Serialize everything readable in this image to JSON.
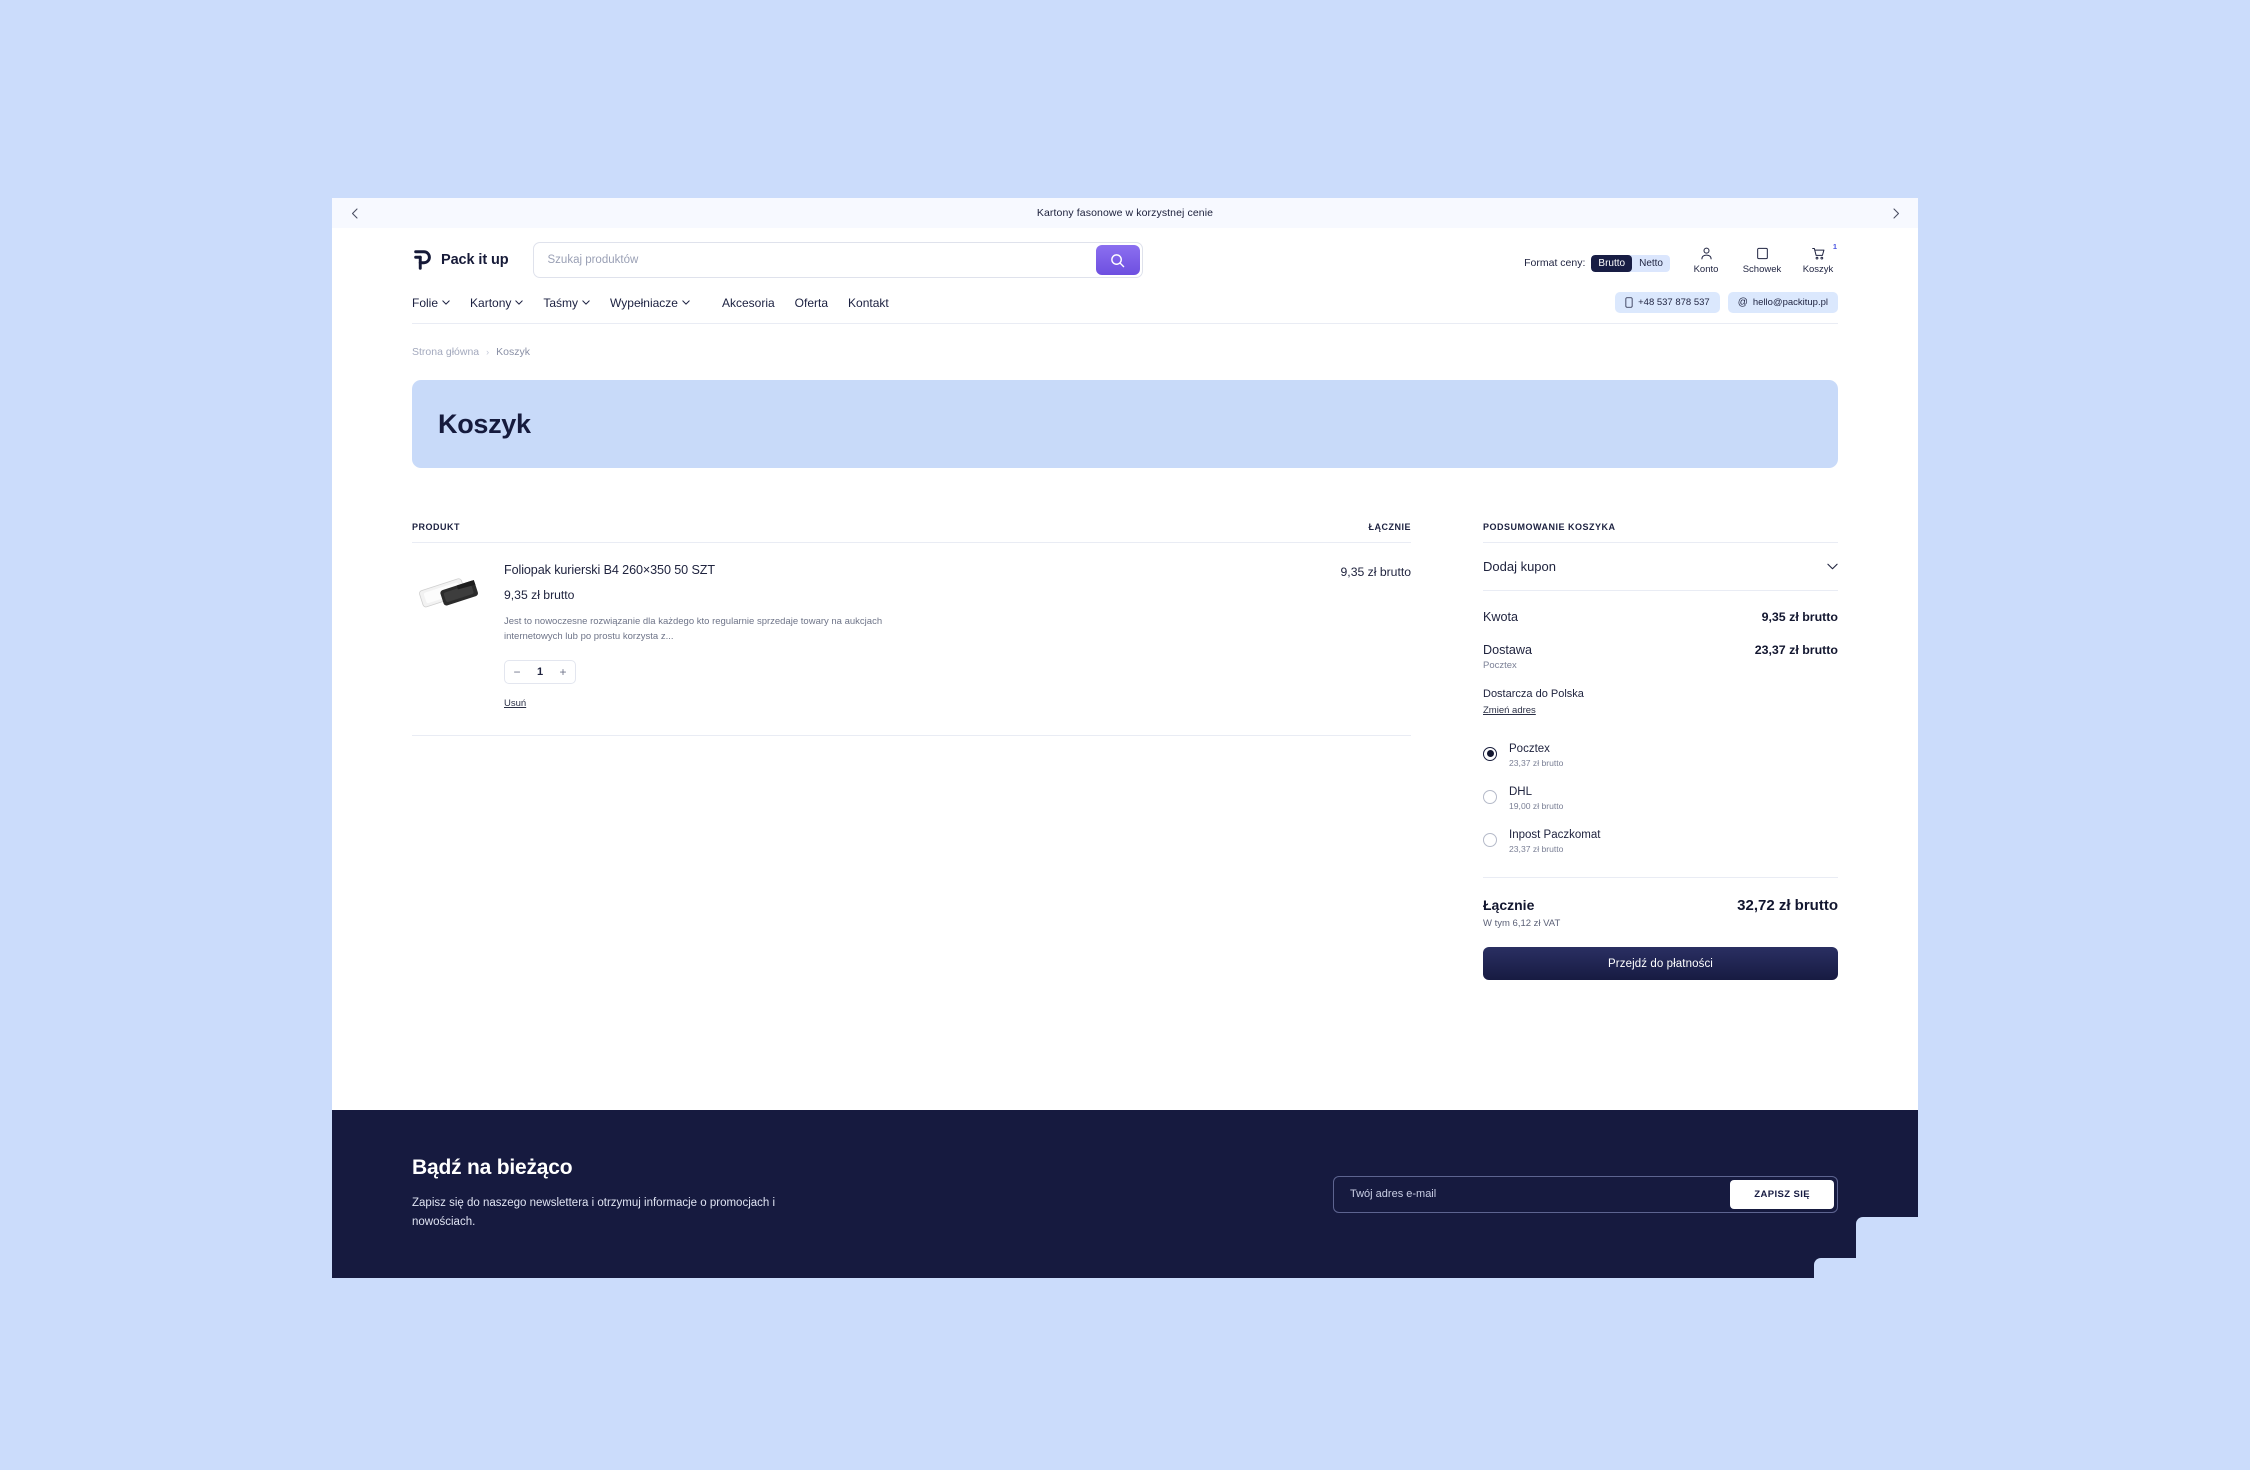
{
  "colors": {
    "page_background": "#cbdcfb",
    "brand_dark": "#161a3f",
    "accent_purple": "#6e4fe0",
    "hero_band": "#c8daf9",
    "pill_blue": "#dbe8fd"
  },
  "announcement": {
    "prev_icon": "chevron-left-icon",
    "text": "Kartony fasonowe w korzystnej cenie",
    "next_icon": "chevron-right-icon"
  },
  "header": {
    "logo_text": "Pack it up",
    "logo_icon": "packitup-p-logo",
    "search": {
      "placeholder": "Szukaj produktów",
      "value": "",
      "button_icon": "search-icon"
    },
    "price_format": {
      "label": "Format ceny:",
      "options": [
        "Brutto",
        "Netto"
      ],
      "selected": "Brutto"
    },
    "utils": [
      {
        "icon": "user-icon",
        "label": "Konto"
      },
      {
        "icon": "bookmark-icon",
        "label": "Schowek"
      },
      {
        "icon": "cart-icon",
        "label": "Koszyk",
        "badge": "1"
      }
    ],
    "nav": [
      {
        "label": "Folie",
        "has_dropdown": true
      },
      {
        "label": "Kartony",
        "has_dropdown": true
      },
      {
        "label": "Taśmy",
        "has_dropdown": true
      },
      {
        "label": "Wypełniacze",
        "has_dropdown": true
      },
      {
        "label": "Akcesoria",
        "has_dropdown": false
      },
      {
        "label": "Oferta",
        "has_dropdown": false
      },
      {
        "label": "Kontakt",
        "has_dropdown": false
      }
    ],
    "contact": {
      "phone_icon": "phone-icon",
      "phone": "+48 537 878 537",
      "email_icon": "at-icon",
      "email": "hello@packitup.pl"
    }
  },
  "breadcrumb": {
    "home": "Strona główna",
    "separator": "›",
    "current": "Koszyk"
  },
  "hero": {
    "title": "Koszyk"
  },
  "cart": {
    "columns": {
      "product": "PRODUKT",
      "total": "ŁĄCZNIE"
    },
    "items": [
      {
        "thumbnail_icon": "poly-mailer-product-image",
        "title": "Foliopak kurierski B4 260×350 50 SZT",
        "price": "9,35 zł brutto",
        "description": "Jest to nowoczesne rozwiązanie dla każdego kto regularnie sprzedaje towary na aukcjach internetowych lub po prostu korzysta z...",
        "qty_minus": "−",
        "quantity": "1",
        "qty_plus": "+",
        "remove_label": "Usuń",
        "line_total": "9,35 zł brutto"
      }
    ]
  },
  "summary": {
    "heading": "PODSUMOWANIE KOSZYKA",
    "coupon": {
      "label": "Dodaj kupon",
      "chevron_icon": "chevron-down-icon"
    },
    "amount": {
      "label": "Kwota",
      "value": "9,35 zł brutto"
    },
    "shipping": {
      "label": "Dostawa",
      "value": "23,37 zł brutto",
      "selected_carrier": "Pocztex"
    },
    "ship_to": {
      "text": "Dostarcza do Polska",
      "change_label": "Zmień adres"
    },
    "options": [
      {
        "name": "Pocztex",
        "price": "23,37 zł brutto",
        "selected": true
      },
      {
        "name": "DHL",
        "price": "19,00 zł brutto",
        "selected": false
      },
      {
        "name": "Inpost Paczkomat",
        "price": "23,37 zł brutto",
        "selected": false
      }
    ],
    "total": {
      "label": "Łącznie",
      "value": "32,72 zł brutto",
      "vat_note": "W tym 6,12 zł VAT"
    },
    "checkout_label": "Przejdź do płatności"
  },
  "newsletter": {
    "title": "Bądź na bieżąco",
    "subtitle": "Zapisz się do naszego newslettera i otrzymuj informacje o promocjach i nowościach.",
    "placeholder": "Twój adres e-mail",
    "value": "",
    "button_label": "ZAPISZ SIĘ"
  }
}
